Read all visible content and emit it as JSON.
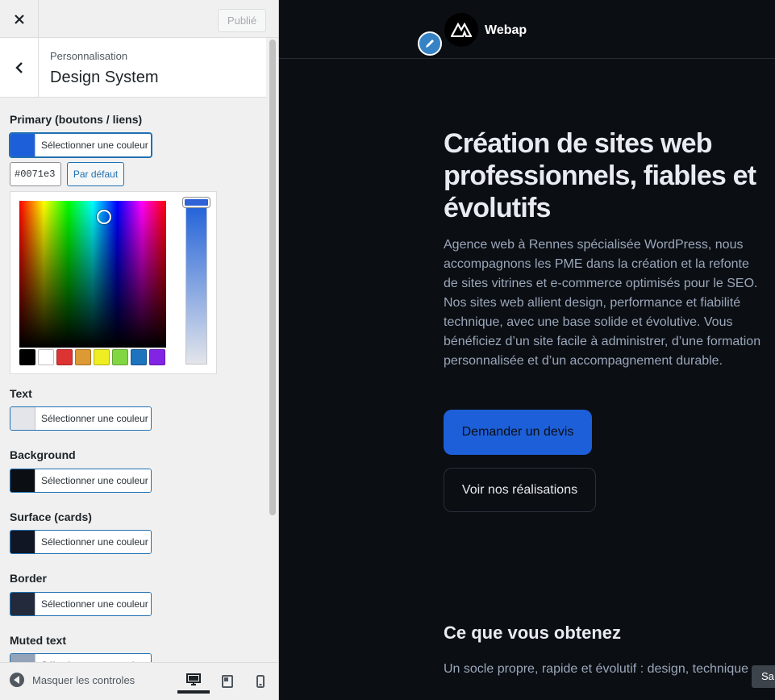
{
  "topbar": {
    "publish_label": "Publié"
  },
  "section": {
    "breadcrumb": "Personnalisation",
    "title": "Design System"
  },
  "controls": [
    {
      "label": "Primary (boutons / liens)",
      "swatch": "#1d5fd8",
      "button_label": "Sélectionner une couleur"
    },
    {
      "label": "Text",
      "swatch": "#e3e5ea",
      "button_label": "Sélectionner une couleur"
    },
    {
      "label": "Background",
      "swatch": "#0b0e13",
      "button_label": "Sélectionner une couleur"
    },
    {
      "label": "Surface (cards)",
      "swatch": "#101624",
      "button_label": "Sélectionner une couleur"
    },
    {
      "label": "Border",
      "swatch": "#222a3c",
      "button_label": "Sélectionner une couleur"
    },
    {
      "label": "Muted text",
      "swatch": "#94a3b8",
      "button_label": "Sélectionner une couleur"
    }
  ],
  "picker": {
    "hex_value": "#0071e3",
    "default_label": "Par défaut",
    "palette": [
      "#000000",
      "#ffffff",
      "#dd3333",
      "#dd9933",
      "#eeee22",
      "#81d742",
      "#1e73be",
      "#8224e3"
    ]
  },
  "footer": {
    "collapse_label": "Masquer les controles"
  },
  "preview": {
    "site_name": "Webap",
    "hero_title": "Création de sites web professionnels, fiables et évolutifs",
    "hero_text": "Agence web à Rennes spécialisée WordPress, nous accompagnons les PME dans la création et la refonte de sites vitrines et e-commerce optimisés pour le SEO. Nos sites web allient design, performance et fiabilité technique, avec une base solide et évolutive. Vous bénéficiez d’un site facile à administrer, d’une formation personnalisée et d’un accompagnement durable.",
    "cta_primary": "Demander un devis",
    "cta_secondary": "Voir nos réalisations",
    "section2_title": "Ce que vous obtenez",
    "section2_text": "Un socle propre, rapide et évolutif : design, technique",
    "save_chip": "Sa"
  }
}
